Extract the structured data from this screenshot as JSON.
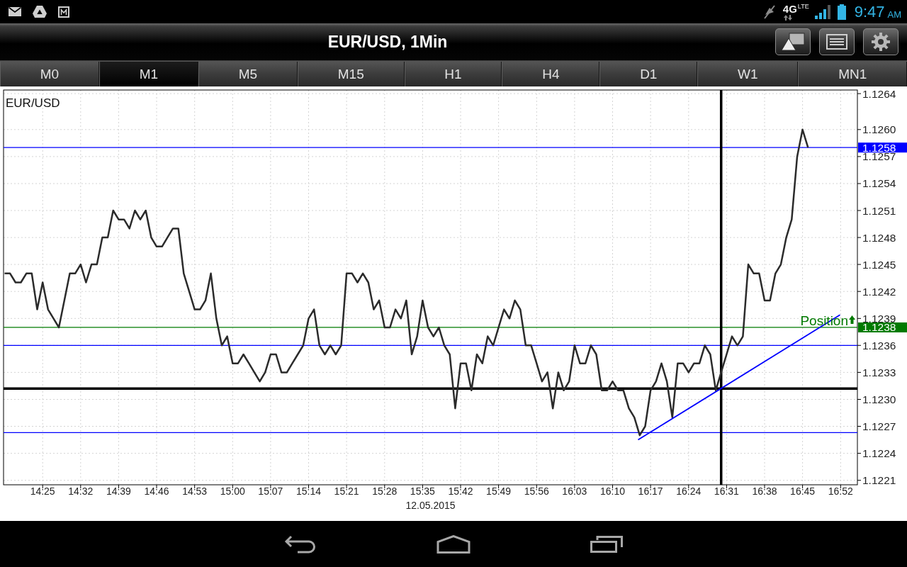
{
  "status_bar": {
    "network": "4G",
    "network_sub": "LTE",
    "time": "9:47",
    "meridiem": "AM"
  },
  "title_bar": {
    "title": "EUR/USD, 1Min"
  },
  "timeframe_tabs": [
    {
      "label": "M0",
      "selected": false
    },
    {
      "label": "M1",
      "selected": true
    },
    {
      "label": "M5",
      "selected": false
    },
    {
      "label": "M15",
      "selected": false
    },
    {
      "label": "H1",
      "selected": false
    },
    {
      "label": "H4",
      "selected": false
    },
    {
      "label": "D1",
      "selected": false
    },
    {
      "label": "W1",
      "selected": false
    },
    {
      "label": "MN1",
      "selected": false
    }
  ],
  "chart": {
    "chart_data": {
      "type": "line",
      "title": "EUR/USD",
      "xlabel": "12.05.2015",
      "grid": true,
      "x": [
        858,
        859,
        860,
        861,
        862,
        863,
        864,
        865,
        866,
        867,
        868,
        869,
        870,
        871,
        872,
        873,
        874,
        875,
        876,
        877,
        878,
        879,
        880,
        881,
        882,
        883,
        884,
        885,
        886,
        887,
        888,
        889,
        890,
        891,
        892,
        893,
        894,
        895,
        896,
        897,
        898,
        899,
        900,
        901,
        902,
        903,
        904,
        905,
        906,
        907,
        908,
        909,
        910,
        911,
        912,
        913,
        914,
        915,
        916,
        917,
        918,
        919,
        920,
        921,
        922,
        923,
        924,
        925,
        926,
        927,
        928,
        929,
        930,
        931,
        932,
        933,
        934,
        935,
        936,
        937,
        938,
        939,
        940,
        941,
        942,
        943,
        944,
        945,
        946,
        947,
        948,
        949,
        950,
        951,
        952,
        953,
        954,
        955,
        956,
        957,
        958,
        959,
        960,
        961,
        962,
        963,
        964,
        965,
        966,
        967,
        968,
        969,
        970,
        971,
        972,
        973,
        974,
        975,
        976,
        977,
        978,
        979,
        980,
        981,
        982,
        983,
        984,
        985,
        986,
        987,
        988,
        989,
        990,
        991,
        992,
        993,
        994,
        995,
        996,
        997,
        998,
        999,
        1000,
        1001,
        1002,
        1003,
        1004,
        1005,
        1006
      ],
      "series": [
        {
          "color": "#2b2b2b",
          "values": [
            1.1244,
            1.1244,
            1.1243,
            1.1243,
            1.1244,
            1.1244,
            1.124,
            1.1243,
            1.124,
            1.1239,
            1.1238,
            1.1241,
            1.1244,
            1.1244,
            1.1245,
            1.1243,
            1.1245,
            1.1245,
            1.1248,
            1.1248,
            1.1251,
            1.125,
            1.125,
            1.1249,
            1.1251,
            1.125,
            1.1251,
            1.1248,
            1.1247,
            1.1247,
            1.1248,
            1.1249,
            1.1249,
            1.1244,
            1.1242,
            1.124,
            1.124,
            1.1241,
            1.1244,
            1.1239,
            1.1236,
            1.1237,
            1.1234,
            1.1234,
            1.1235,
            1.1234,
            1.1233,
            1.1232,
            1.1233,
            1.1235,
            1.1235,
            1.1233,
            1.1233,
            1.1234,
            1.1235,
            1.1236,
            1.1239,
            1.124,
            1.1236,
            1.1235,
            1.1236,
            1.1235,
            1.1236,
            1.1244,
            1.1244,
            1.1243,
            1.1244,
            1.1243,
            1.124,
            1.1241,
            1.1238,
            1.1238,
            1.124,
            1.1239,
            1.1241,
            1.1235,
            1.1237,
            1.1241,
            1.1238,
            1.1237,
            1.1238,
            1.1236,
            1.1235,
            1.1229,
            1.1234,
            1.1234,
            1.1231,
            1.1235,
            1.1234,
            1.1237,
            1.1236,
            1.1238,
            1.124,
            1.1239,
            1.1241,
            1.124,
            1.1236,
            1.1236,
            1.1234,
            1.1232,
            1.1233,
            1.1229,
            1.1233,
            1.1231,
            1.1232,
            1.1236,
            1.1234,
            1.1234,
            1.1236,
            1.1235,
            1.1231,
            1.1231,
            1.1232,
            1.1231,
            1.1231,
            1.1229,
            1.1228,
            1.1226,
            1.1227,
            1.1231,
            1.1232,
            1.1234,
            1.1232,
            1.1228,
            1.1234,
            1.1234,
            1.1233,
            1.1234,
            1.1234,
            1.1236,
            1.1235,
            1.1231,
            1.1233,
            1.1235,
            1.1237,
            1.1236,
            1.1237,
            1.1245,
            1.1244,
            1.1244,
            1.1241,
            1.1241,
            1.1244,
            1.1245,
            1.1248,
            1.125,
            1.1257,
            1.126,
            1.1258
          ]
        },
        {
          "color": "#0000ff",
          "x": [
            974.7,
            1011.9
          ],
          "values": [
            1.12255,
            1.12394
          ]
        }
      ],
      "xlim": [
        857.8,
        1015.1
      ],
      "ylim": [
        1.12205,
        1.12644
      ],
      "xticks": [
        {
          "value": 865,
          "label": "14:25"
        },
        {
          "value": 872,
          "label": "14:32"
        },
        {
          "value": 879,
          "label": "14:39"
        },
        {
          "value": 886,
          "label": "14:46"
        },
        {
          "value": 893,
          "label": "14:53"
        },
        {
          "value": 900,
          "label": "15:00"
        },
        {
          "value": 907,
          "label": "15:07"
        },
        {
          "value": 914,
          "label": "15:14"
        },
        {
          "value": 921,
          "label": "15:21"
        },
        {
          "value": 928,
          "label": "15:28"
        },
        {
          "value": 935,
          "label": "15:35"
        },
        {
          "value": 942,
          "label": "15:42"
        },
        {
          "value": 949,
          "label": "15:49"
        },
        {
          "value": 956,
          "label": "15:56"
        },
        {
          "value": 963,
          "label": "16:03"
        },
        {
          "value": 970,
          "label": "16:10"
        },
        {
          "value": 977,
          "label": "16:17"
        },
        {
          "value": 984,
          "label": "16:24"
        },
        {
          "value": 991,
          "label": "16:31"
        },
        {
          "value": 998,
          "label": "16:38"
        },
        {
          "value": 1005,
          "label": "16:45"
        },
        {
          "value": 1012,
          "label": "16:52"
        }
      ],
      "yticks": [
        {
          "value": 1.1264,
          "label": "1.1264"
        },
        {
          "value": 1.126,
          "label": "1.1260"
        },
        {
          "value": 1.1257,
          "label": "1.1257"
        },
        {
          "value": 1.1254,
          "label": "1.1254"
        },
        {
          "value": 1.1251,
          "label": "1.1251"
        },
        {
          "value": 1.1248,
          "label": "1.1248"
        },
        {
          "value": 1.1245,
          "label": "1.1245"
        },
        {
          "value": 1.1242,
          "label": "1.1242"
        },
        {
          "value": 1.1239,
          "label": "1.1239"
        },
        {
          "value": 1.1236,
          "label": "1.1236"
        },
        {
          "value": 1.1233,
          "label": "1.1233"
        },
        {
          "value": 1.123,
          "label": "1.1230"
        },
        {
          "value": 1.1227,
          "label": "1.1227"
        },
        {
          "value": 1.1224,
          "label": "1.1224"
        },
        {
          "value": 1.1221,
          "label": "1.1221"
        }
      ],
      "ref_lines": [
        {
          "axis": "y",
          "value": 1.1258,
          "color": "#0000ff",
          "label": "1.1258"
        },
        {
          "axis": "y",
          "value": 1.1238,
          "color": "#007a00",
          "label": "1.1238"
        },
        {
          "axis": "y",
          "value": 1.1236,
          "color": "#0000ff"
        },
        {
          "axis": "y",
          "value": 1.12263,
          "color": "#0000ff"
        },
        {
          "axis": "y",
          "value": 1.12312,
          "color": "#000000"
        },
        {
          "axis": "x",
          "value": 990,
          "color": "#000000"
        }
      ],
      "annotations": [
        {
          "text": "Position",
          "y": 1.1238
        }
      ]
    }
  }
}
